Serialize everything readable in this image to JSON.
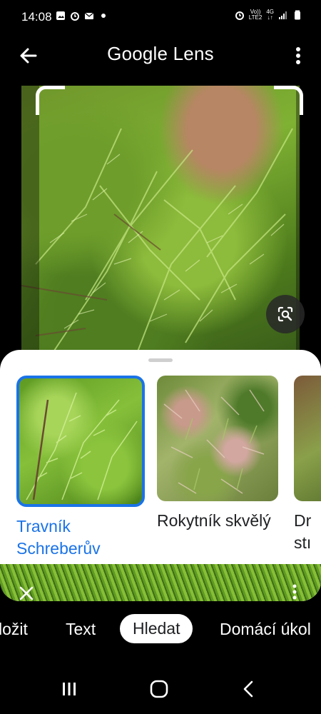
{
  "status_bar": {
    "time": "14:08",
    "network_top": "Vo))",
    "network_bottom": "LTE2",
    "network_gen": "4G"
  },
  "header": {
    "title_google": "Google",
    "title_lens": "Lens",
    "back_icon": "arrow-left-icon",
    "menu_icon": "more-vert-icon"
  },
  "results": [
    {
      "label": "Travník Schreberův",
      "selected": true
    },
    {
      "label": "Rokytník skvělý",
      "selected": false
    },
    {
      "label": "Dr\nstı",
      "selected": false
    }
  ],
  "modes": {
    "items": [
      "ložit",
      "Text",
      "Hledat",
      "Domácí úkol"
    ],
    "active": "Hledat"
  },
  "colors": {
    "accent": "#1a73e8",
    "background": "#000000",
    "sheet": "#ffffff"
  }
}
